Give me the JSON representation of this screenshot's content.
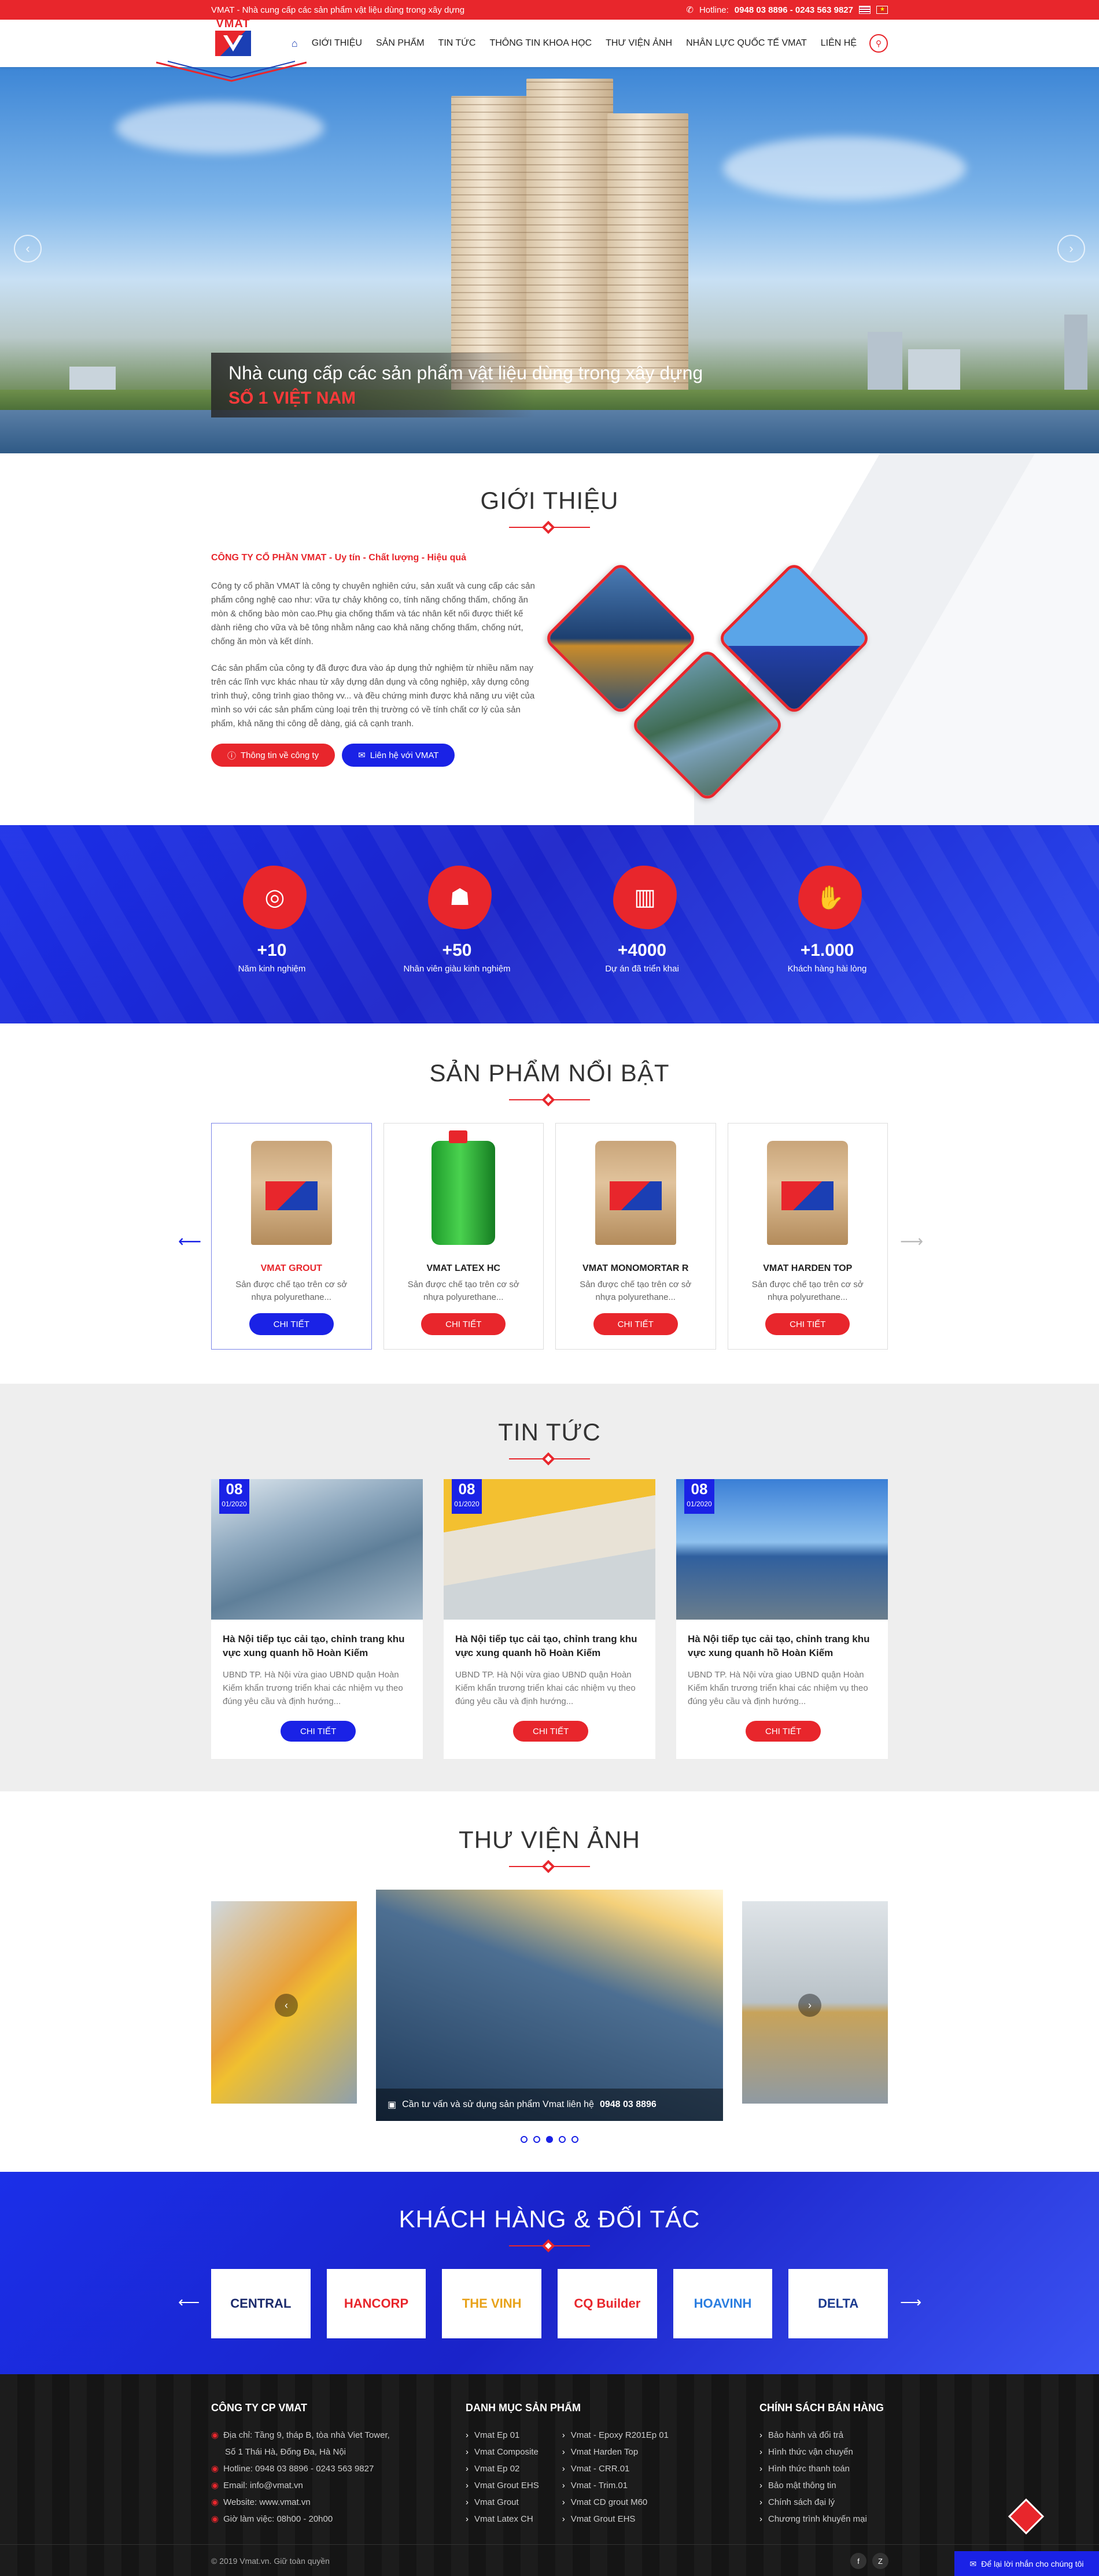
{
  "topbar": {
    "tagline": "VMAT - Nhà cung cấp các sản phẩm vật liệu dùng trong xây dựng",
    "hotline_label": "Hotline:",
    "hotline": "0948 03 8896 - 0243 563 9827"
  },
  "logo": {
    "text": "VMAT"
  },
  "nav": {
    "items": [
      "GIỚI THIỆU",
      "SẢN PHẨM",
      "TIN TỨC",
      "THÔNG TIN KHOA HỌC",
      "THƯ VIỆN ẢNH",
      "NHÂN LỰC QUỐC TẾ VMAT",
      "LIÊN HỆ"
    ]
  },
  "hero": {
    "line1": "Nhà cung cấp các sản phẩm vật liệu dùng trong xây dựng",
    "line2": "SỐ 1 VIỆT NAM"
  },
  "intro": {
    "title": "GIỚI THIỆU",
    "lead": "CÔNG TY CỔ PHẦN VMAT - Uy tín - Chất lượng - Hiệu quả",
    "p1": "Công ty cổ phần VMAT là công ty chuyên nghiên cứu, sản xuất và cung cấp các sản phẩm công nghệ cao như: vữa tự chảy không co, tính năng chống thấm, chống ăn mòn & chống bào mòn cao.Phụ gia chống thấm và tác nhân kết nối được thiết kế dành riêng cho vữa và bê tông nhằm nâng cao khả năng chống thấm, chống nứt, chống ăn mòn và kết dính.",
    "p2": "Các sản phẩm của công ty đã được đưa vào áp dụng thử nghiệm từ nhiều năm nay trên các lĩnh vực khác nhau từ xây dựng dân dụng và công nghiệp, xây dựng công trình thuỷ, công trình giao thông vv... và đều chứng minh được khả năng ưu việt của mình so với các sản phẩm cùng loại trên thị trường có về tính chất cơ lý của sản phẩm, khả năng thi công dễ dàng, giá cả cạnh tranh.",
    "btn_info": "Thông tin về công ty",
    "btn_contact": "Liên hệ với VMAT"
  },
  "stats": [
    {
      "num": "+10",
      "label": "Năm kinh nghiệm",
      "icon": "target-icon"
    },
    {
      "num": "+50",
      "label": "Nhân viên giàu kinh nghiệm",
      "icon": "team-icon"
    },
    {
      "num": "+4000",
      "label": "Dự án đã triển khai",
      "icon": "buildings-icon"
    },
    {
      "num": "+1.000",
      "label": "Khách hàng hài lòng",
      "icon": "handshake-icon"
    }
  ],
  "products": {
    "title": "SẢN PHẨM NỔI BẬT",
    "items": [
      {
        "name": "VMAT GROUT",
        "desc": "Sản được chế tạo trên cơ sở nhựa polyurethane...",
        "btn": "CHI TIẾT"
      },
      {
        "name": "VMAT LATEX HC",
        "desc": "Sản được chế tạo trên cơ sở nhựa polyurethane...",
        "btn": "CHI TIẾT"
      },
      {
        "name": "VMAT MONOMORTAR R",
        "desc": "Sản được chế tạo trên cơ sở nhựa polyurethane...",
        "btn": "CHI TIẾT"
      },
      {
        "name": "VMAT HARDEN TOP",
        "desc": "Sản được chế tạo trên cơ sở nhựa polyurethane...",
        "btn": "CHI TIẾT"
      }
    ]
  },
  "news": {
    "title": "TIN TỨC",
    "items": [
      {
        "day": "08",
        "month": "01/2020",
        "title": "Hà Nội tiếp tục cải tạo, chỉnh trang khu vực xung quanh hồ Hoàn Kiếm",
        "excerpt": "UBND TP. Hà Nội vừa giao UBND quận Hoàn Kiếm khẩn trương triển khai các nhiệm vụ theo đúng yêu cầu và định hướng...",
        "btn": "CHI TIẾT"
      },
      {
        "day": "08",
        "month": "01/2020",
        "title": "Hà Nội tiếp tục cải tạo, chỉnh trang khu vực xung quanh hồ Hoàn Kiếm",
        "excerpt": "UBND TP. Hà Nội vừa giao UBND quận Hoàn Kiếm khẩn trương triển khai các nhiệm vụ theo đúng yêu cầu và định hướng...",
        "btn": "CHI TIẾT"
      },
      {
        "day": "08",
        "month": "01/2020",
        "title": "Hà Nội tiếp tục cải tạo, chỉnh trang khu vực xung quanh hồ Hoàn Kiếm",
        "excerpt": "UBND TP. Hà Nội vừa giao UBND quận Hoàn Kiếm khẩn trương triển khai các nhiệm vụ theo đúng yêu cầu và định hướng...",
        "btn": "CHI TIẾT"
      }
    ]
  },
  "gallery": {
    "title": "THƯ VIỆN ẢNH",
    "caption": "Cần tư vấn và sử dụng sản phẩm Vmat liên hệ",
    "caption_phone": "0948 03 8896",
    "active_dot": 3,
    "dot_count": 5
  },
  "partners": {
    "title": "KHÁCH HÀNG & ĐỐI TÁC",
    "logos": [
      {
        "name": "CENTRAL",
        "color": "#1b2a6b"
      },
      {
        "name": "HANCORP",
        "color": "#e8262c"
      },
      {
        "name": "THE VINH",
        "color": "#e8a21a"
      },
      {
        "name": "CQ Builder",
        "color": "#e8262c"
      },
      {
        "name": "HOAVINH",
        "color": "#2a7de0"
      },
      {
        "name": "DELTA",
        "color": "#1b3a8f"
      }
    ]
  },
  "footer": {
    "company_title": "CÔNG TY CP VMAT",
    "contact": [
      "Địa chỉ: Tầng 9, tháp B, tòa nhà Viet Tower,",
      "Số 1 Thái Hà, Đống Đa, Hà Nội",
      "Hotline: 0948 03 8896 - 0243 563 9827",
      "Email: info@vmat.vn",
      "Website: www.vmat.vn",
      "Giờ làm việc: 08h00 - 20h00"
    ],
    "catalog_title": "DANH MỤC SẢN PHẨM",
    "catalog_col1": [
      "Vmat Ep 01",
      "Vmat Composite",
      "Vmat Ep 02",
      "Vmat Grout EHS",
      "Vmat Grout",
      "Vmat Latex CH"
    ],
    "catalog_col2": [
      "Vmat - Epoxy R201Ep 01",
      "Vmat Harden Top",
      "Vmat - CRR.01",
      "Vmat - Trim.01",
      "Vmat CD grout M60",
      "Vmat Grout EHS"
    ],
    "policy_title": "CHÍNH SÁCH BÁN HÀNG",
    "policy": [
      "Bảo hành và đổi trả",
      "Hình thức vận chuyển",
      "Hình thức thanh toán",
      "Bảo mật thông tin",
      "Chính sách đại lý",
      "Chương trình khuyến mại"
    ],
    "copyright": "© 2019 Vmat.vn. Giữ toàn quyền",
    "chat": "Để lại lời nhắn cho chúng tôi"
  }
}
